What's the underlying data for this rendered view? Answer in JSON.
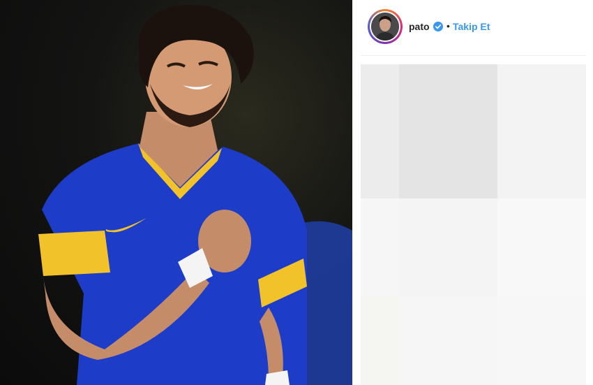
{
  "post": {
    "photo_icon": "player-photo",
    "header": {
      "username": "pato",
      "verified_icon": "verified-badge-icon",
      "separator": "•",
      "follow_label": "Takip Et"
    },
    "colors": {
      "follow": "#3897f0",
      "username": "#262626",
      "placeholder_dark": "#e6e6e6",
      "placeholder_light": "#f7f7f7"
    }
  }
}
